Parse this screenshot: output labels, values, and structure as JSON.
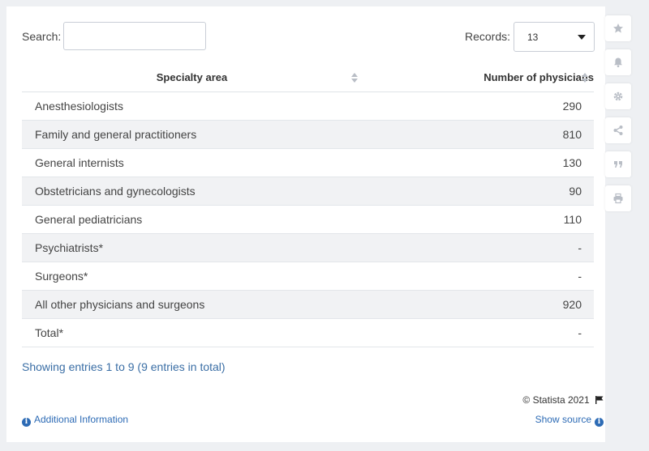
{
  "search": {
    "label": "Search:",
    "value": "",
    "placeholder": ""
  },
  "records": {
    "label": "Records:",
    "value": "13"
  },
  "table": {
    "headers": [
      "Specialty area",
      "Number of physicians"
    ],
    "rows": [
      {
        "specialty": "Anesthesiologists",
        "count": "290"
      },
      {
        "specialty": "Family and general practitioners",
        "count": "810"
      },
      {
        "specialty": "General internists",
        "count": "130"
      },
      {
        "specialty": "Obstetricians and gynecologists",
        "count": "90"
      },
      {
        "specialty": "General pediatricians",
        "count": "110"
      },
      {
        "specialty": "Psychiatrists*",
        "count": "-"
      },
      {
        "specialty": "Surgeons*",
        "count": "-"
      },
      {
        "specialty": "All other physicians and surgeons",
        "count": "920"
      },
      {
        "specialty": "Total*",
        "count": "-"
      }
    ]
  },
  "footer": {
    "entries_info": "Showing entries 1 to 9 (9 entries in total)",
    "copyright": "© Statista 2021",
    "additional_info": "Additional Information",
    "show_source": "Show source"
  },
  "toolbar": {
    "icons": [
      "star-icon",
      "bell-icon",
      "gear-icon",
      "share-icon",
      "quote-icon",
      "print-icon"
    ]
  },
  "colors": {
    "background": "#eef0f3",
    "link": "#2d6bb5",
    "row_alt": "#f1f2f4",
    "icon": "#b9bec6"
  }
}
